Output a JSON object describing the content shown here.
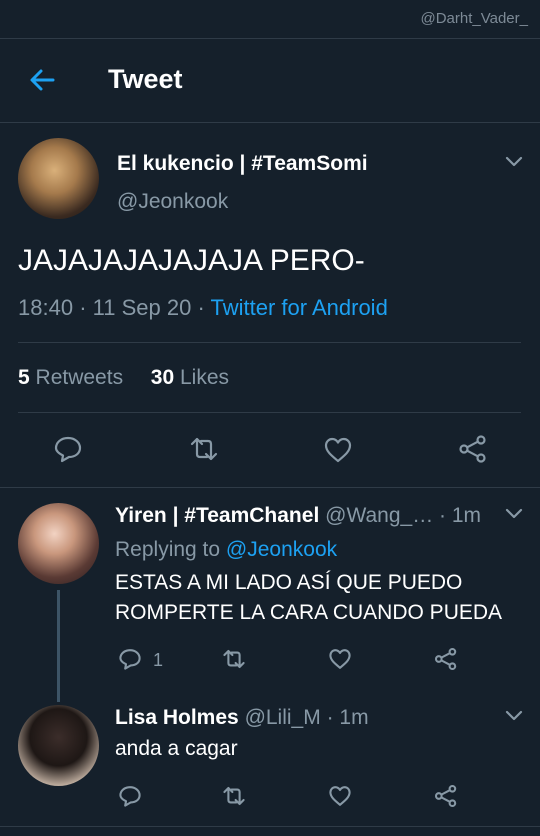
{
  "watermark": "@Darht_Vader_",
  "header": {
    "title": "Tweet"
  },
  "tweet": {
    "name": "El kukencio | #TeamSomi",
    "handle": "@Jeonkook",
    "text": "JAJAJAJAJAJAJA PERO-",
    "time": "18:40",
    "date": "11 Sep 20",
    "source": "Twitter for Android",
    "retweets_count": "5",
    "retweets_label": "Retweets",
    "likes_count": "30",
    "likes_label": "Likes"
  },
  "replies": [
    {
      "name": "Yiren | #TeamChanel",
      "handle": "@Wang_…",
      "age": "· 1m",
      "replying_prefix": "Replying to",
      "replying_to": "@Jeonkook",
      "text_line1": "ESTAS A MI LADO ASÍ QUE PUEDO",
      "text_line2": "ROMPERTE LA CARA CUANDO PUEDA",
      "reply_count": "1"
    },
    {
      "name": "Lisa Holmes",
      "handle": "@Lili_M",
      "age": "· 1m",
      "text": "anda a cagar"
    }
  ],
  "icons": {
    "back": "back-arrow-icon",
    "more": "chevron-down-icon",
    "reply": "comment-icon",
    "retweet": "retweet-icon",
    "like": "heart-icon",
    "share": "share-icon"
  },
  "colors": {
    "background": "#15202b",
    "accent": "#1da1f2",
    "muted": "#8899a6",
    "divider": "#2f3b47"
  }
}
